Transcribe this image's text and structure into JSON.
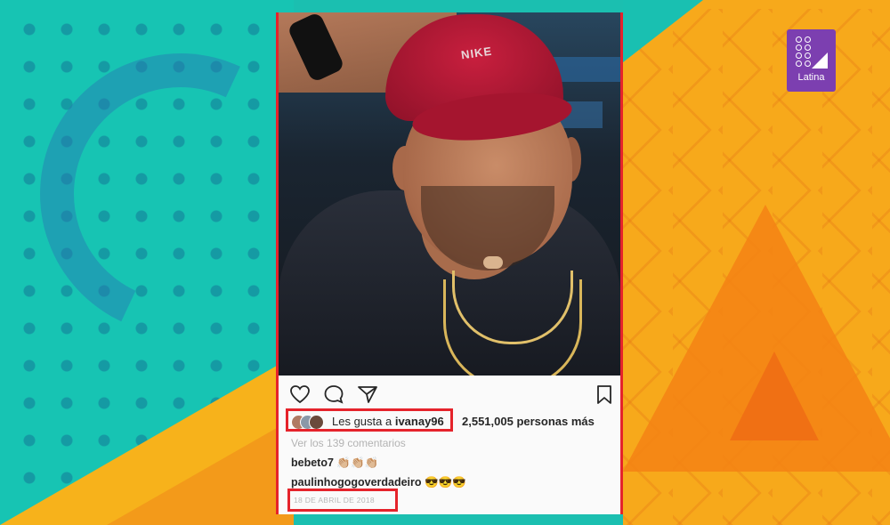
{
  "channel_logo": {
    "text": "Latina",
    "brand_color": "#7c3fb0"
  },
  "post": {
    "likes": {
      "prefix": "Les gusta a ",
      "user": "ivanay96",
      "rest": "2,551,005 personas más"
    },
    "view_comments": "Ver los 139 comentarios",
    "comments": [
      {
        "user": "bebeto7",
        "text": "👏🏼👏🏼👏🏼"
      },
      {
        "user": "paulinhogogoverdadeiro",
        "text": "😎😎😎"
      }
    ],
    "date": "18 DE ABRIL DE 2018",
    "photo_cap_brand": "NIKE",
    "highlight_color": "#e5232b"
  },
  "icons": [
    "heart-icon",
    "comment-icon",
    "share-icon",
    "bookmark-icon"
  ]
}
